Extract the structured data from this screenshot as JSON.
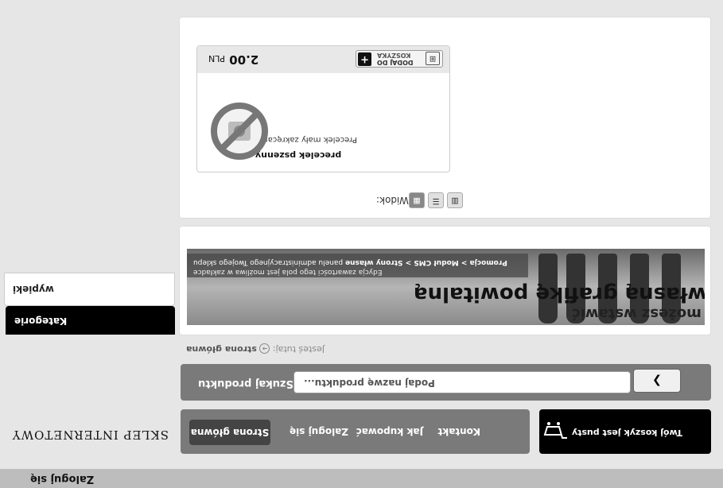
{
  "topbar": {
    "login": "Zaloguj się"
  },
  "shop": {
    "title": "SKLEP INTERNETOWY"
  },
  "nav": {
    "items": [
      "Strona główna",
      "Zaloguj się",
      "Jak kupować",
      "Kontakt"
    ]
  },
  "cart": {
    "status": "Twój koszyk jest pusty",
    "icon": "cart-icon"
  },
  "search": {
    "label": "Szukaj produktu",
    "placeholder": "Podaj nazwę produktu...",
    "button_icon": "chevron-right-icon",
    "button_glyph": "❯"
  },
  "breadcrumb": {
    "prefix": "Jesteś tutaj:",
    "home": "strona główna"
  },
  "categories": {
    "header": "Kategorie",
    "items": [
      "wypieki"
    ]
  },
  "banner": {
    "line1": "Tu możesz wstawić",
    "line2": "własną grafikę powitalną",
    "path_bold": "Promocja > Moduł CMS > Strony własne",
    "path_rest": "panelu administracyjnego Twojego sklepu",
    "note": "Edycja zawartości tego pola jest możliwa w zakładce"
  },
  "view": {
    "label": "Widok:",
    "modes": [
      "grid-view-icon",
      "list-view-icon",
      "gallery-view-icon"
    ]
  },
  "product": {
    "name": "precelek pszenny",
    "description": "Precelek mały zakręcany w lewo",
    "image": "no-image-icon",
    "price": "2.00",
    "currency": "PLN",
    "add_line1": "DODAJ DO",
    "add_line2": "KOSZYKA"
  },
  "colors": {
    "dark": "#000000",
    "bar": "#7a7a7a",
    "bg": "#e6e6e6"
  }
}
